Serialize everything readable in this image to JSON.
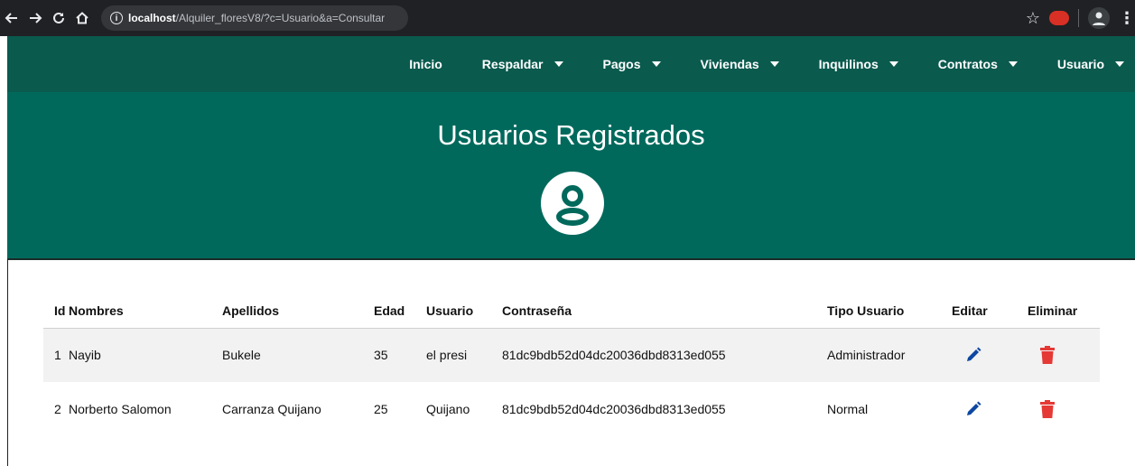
{
  "browser": {
    "url_host": "localhost",
    "url_path": "/Alquiler_floresV8/?c=Usuario&a=Consultar"
  },
  "navbar": {
    "items": [
      {
        "label": "Inicio",
        "dropdown": false
      },
      {
        "label": "Respaldar",
        "dropdown": true
      },
      {
        "label": "Pagos",
        "dropdown": true
      },
      {
        "label": "Viviendas",
        "dropdown": true
      },
      {
        "label": "Inquilinos",
        "dropdown": true
      },
      {
        "label": "Contratos",
        "dropdown": true
      },
      {
        "label": "Usuario",
        "dropdown": true
      }
    ]
  },
  "hero": {
    "title": "Usuarios Registrados",
    "icon": "user-circle-icon"
  },
  "table": {
    "headers": {
      "id": "Id",
      "nombres": "Nombres",
      "apellidos": "Apellidos",
      "edad": "Edad",
      "usuario": "Usuario",
      "contrasena": "Contraseña",
      "tipo": "Tipo Usuario",
      "editar": "Editar",
      "eliminar": "Eliminar"
    },
    "rows": [
      {
        "id": "1",
        "nombres": "Nayib",
        "apellidos": "Bukele",
        "edad": "35",
        "usuario": "el presi",
        "contrasena": "81dc9bdb52d04dc20036dbd8313ed055",
        "tipo": "Administrador"
      },
      {
        "id": "2",
        "nombres": "Norberto Salomon",
        "apellidos": "Carranza Quijano",
        "edad": "25",
        "usuario": "Quijano",
        "contrasena": "81dc9bdb52d04dc20036dbd8313ed055",
        "tipo": "Normal"
      }
    ]
  },
  "colors": {
    "navbar": "#0a5a4e",
    "hero": "#00695c",
    "edit": "#0d47a1",
    "delete": "#e53935"
  }
}
